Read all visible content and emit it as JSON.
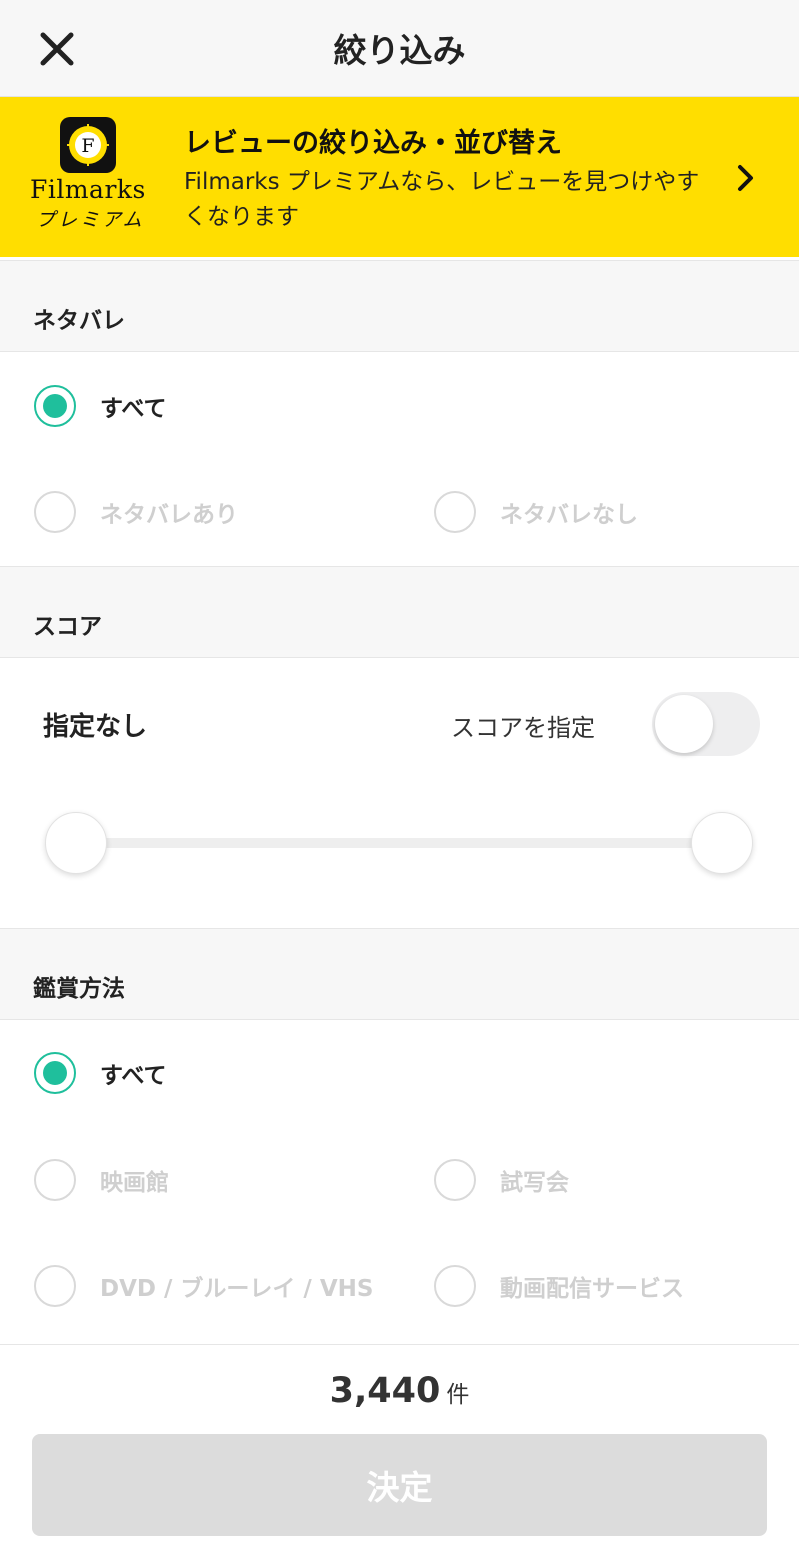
{
  "header": {
    "title": "絞り込み"
  },
  "banner": {
    "title": "レビューの絞り込み・並び替え",
    "description": "Filmarks プレミアムなら、レビューを見つけやすくなります",
    "brand": "Filmarks",
    "brand_sub": "プレミアム",
    "logo_letter": "F"
  },
  "spoiler": {
    "title": "ネタバレ",
    "options": [
      {
        "label": "すべて",
        "selected": true
      },
      {
        "label": "ネタバレあり",
        "selected": false
      },
      {
        "label": "ネタバレなし",
        "selected": false
      }
    ]
  },
  "score": {
    "title": "スコア",
    "value_text": "指定なし",
    "toggle_label": "スコアを指定",
    "toggle_on": false,
    "range_min_fraction": 0,
    "range_max_fraction": 1
  },
  "viewing": {
    "title": "鑑賞方法",
    "options": [
      {
        "label": "すべて",
        "selected": true
      },
      {
        "label": "映画館",
        "selected": false
      },
      {
        "label": "試写会",
        "selected": false
      },
      {
        "label": "DVD / ブルーレイ / VHS",
        "selected": false
      },
      {
        "label": "動画配信サービス",
        "selected": false
      }
    ]
  },
  "footer": {
    "count": "3,440",
    "count_unit": "件",
    "submit_label": "決定"
  },
  "colors": {
    "accent": "#1fbf9c",
    "banner": "#ffde00",
    "disabled_button": "#dcdcdc"
  }
}
